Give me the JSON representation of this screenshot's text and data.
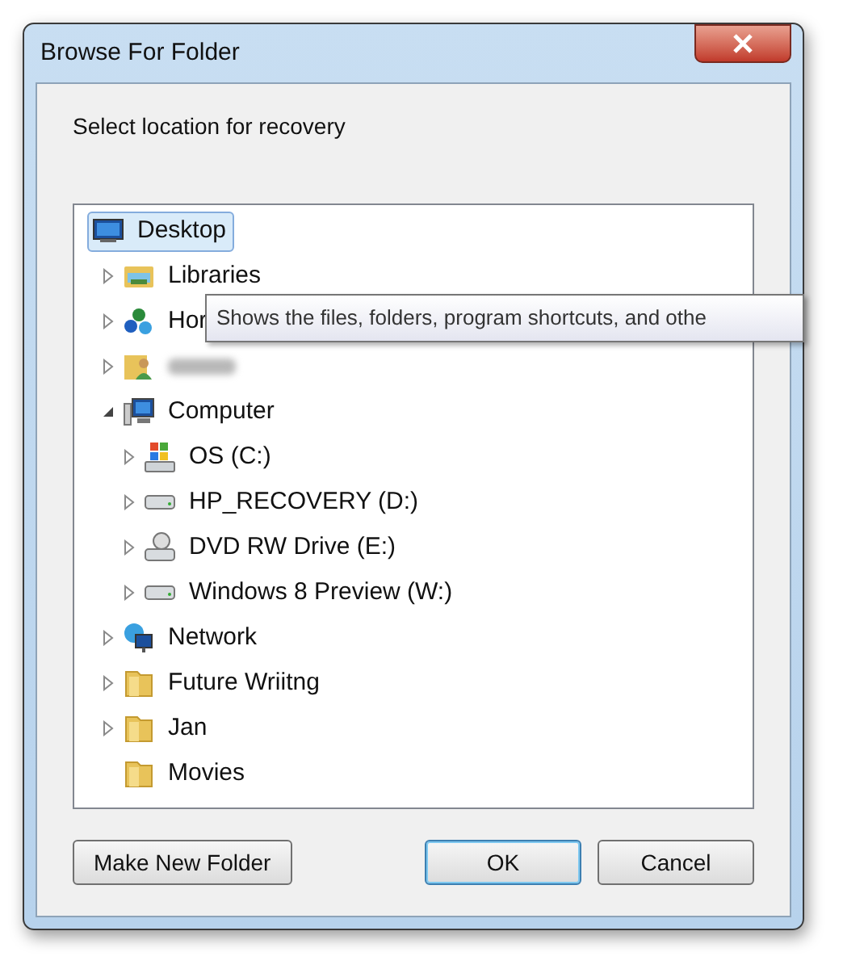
{
  "window": {
    "title": "Browse For Folder"
  },
  "instruction": "Select location for recovery",
  "tree": [
    {
      "label": "Desktop",
      "kind": "desktop",
      "selected": true,
      "children": [
        {
          "label": "Libraries",
          "kind": "library",
          "selected": false,
          "expandable": true,
          "expanded": false
        },
        {
          "label": "Hor",
          "kind": "homegroup",
          "selected": false,
          "expandable": true,
          "expanded": false
        },
        {
          "kind": "user",
          "selected": false,
          "expandable": true,
          "expanded": false,
          "redacted": true
        },
        {
          "label": "Computer",
          "kind": "computer",
          "selected": false,
          "expandable": true,
          "expanded": true,
          "children": [
            {
              "label": "OS (C:)",
              "kind": "system-drive",
              "selected": false,
              "expandable": true,
              "expanded": false
            },
            {
              "label": "HP_RECOVERY (D:)",
              "kind": "drive",
              "selected": false,
              "expandable": true,
              "expanded": false
            },
            {
              "label": "DVD RW Drive (E:)",
              "kind": "dvd",
              "selected": false,
              "expandable": true,
              "expanded": false
            },
            {
              "label": "Windows 8 Preview (W:)",
              "kind": "drive",
              "selected": false,
              "expandable": true,
              "expanded": false
            }
          ]
        },
        {
          "label": "Network",
          "kind": "network",
          "selected": false,
          "expandable": true,
          "expanded": false
        },
        {
          "label": "Future Wriitng",
          "kind": "folder",
          "selected": false,
          "expandable": true,
          "expanded": false
        },
        {
          "label": "Jan",
          "kind": "folder",
          "selected": false,
          "expandable": true,
          "expanded": false
        },
        {
          "label": "Movies",
          "kind": "folder",
          "selected": false,
          "expandable": false
        }
      ]
    }
  ],
  "tooltip": "Shows the files, folders, program shortcuts, and othe",
  "buttons": [
    {
      "label": "Make New Folder",
      "default": false
    },
    {
      "label": "OK",
      "default": true
    },
    {
      "label": "Cancel",
      "default": false
    }
  ]
}
